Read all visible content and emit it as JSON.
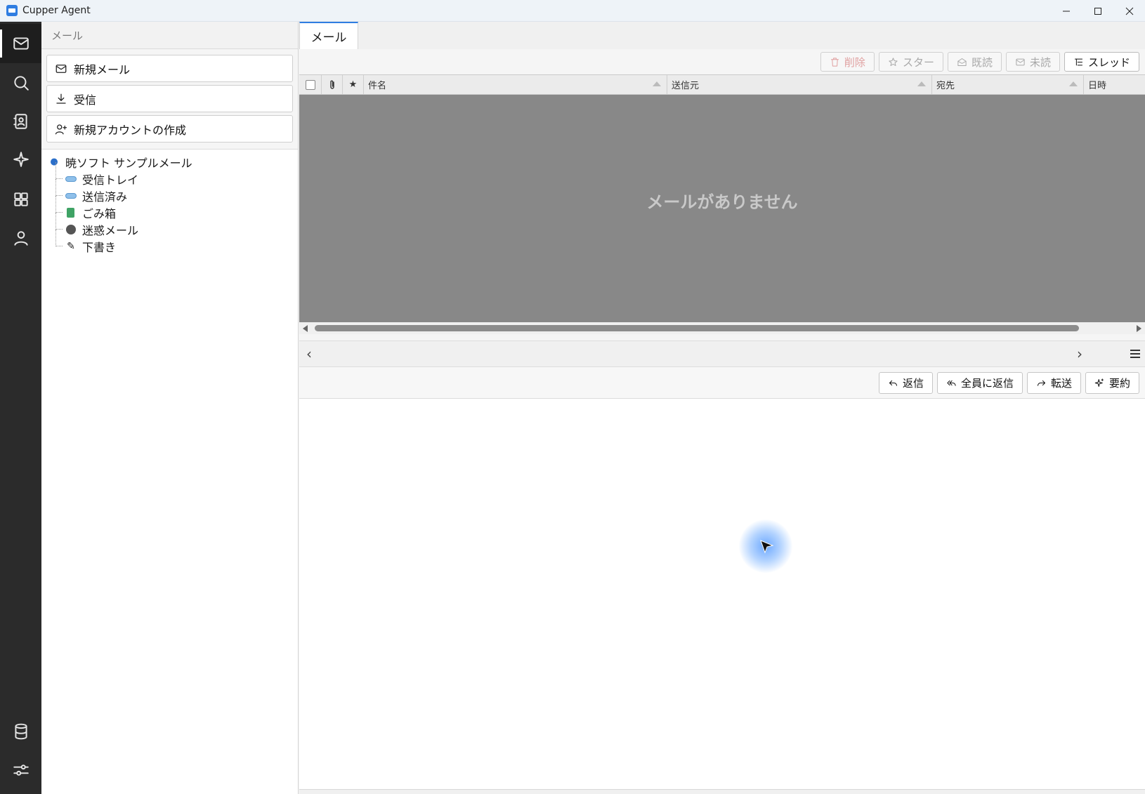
{
  "window": {
    "title": "Cupper Agent",
    "controls": [
      "minimize-icon",
      "maximize-icon",
      "close-icon"
    ]
  },
  "rail": {
    "top_icons": [
      "mail-icon",
      "search-icon",
      "contacts-icon",
      "sparkle-icon",
      "apps-grid-icon",
      "user-icon"
    ],
    "bottom_icons": [
      "database-icon",
      "settings-sliders-icon"
    ],
    "active": "mail-icon"
  },
  "sidebar": {
    "header": "メール",
    "actions": {
      "new_mail": "新規メール",
      "receive": "受信",
      "new_account": "新規アカウントの作成"
    },
    "account": "暁ソフト サンプルメール",
    "folders": [
      {
        "label": "受信トレイ",
        "icon": "inbox-icon"
      },
      {
        "label": "送信済み",
        "icon": "sent-icon"
      },
      {
        "label": "ごみ箱",
        "icon": "trash-icon"
      },
      {
        "label": "迷惑メール",
        "icon": "spam-icon"
      },
      {
        "label": "下書き",
        "icon": "draft-icon"
      }
    ]
  },
  "tabs": [
    "メール"
  ],
  "toolbar": {
    "delete": "削除",
    "star": "スター",
    "mark_read": "既読",
    "mark_unread": "未読",
    "thread": "スレッド"
  },
  "grid": {
    "columns": {
      "subject": "件名",
      "from": "送信元",
      "to": "宛先",
      "date": "日時"
    },
    "empty_message": "メールがありません"
  },
  "pager": {
    "prev": "‹",
    "next": "›"
  },
  "message_actions": {
    "reply": "返信",
    "reply_all": "全員に返信",
    "forward": "転送",
    "summarize": "要約"
  },
  "colors": {
    "accent": "#2f7de1",
    "rail_bg": "#2b2b2b",
    "empty_grid_bg": "#888888",
    "delete_disabled": "#e0a0a0"
  }
}
